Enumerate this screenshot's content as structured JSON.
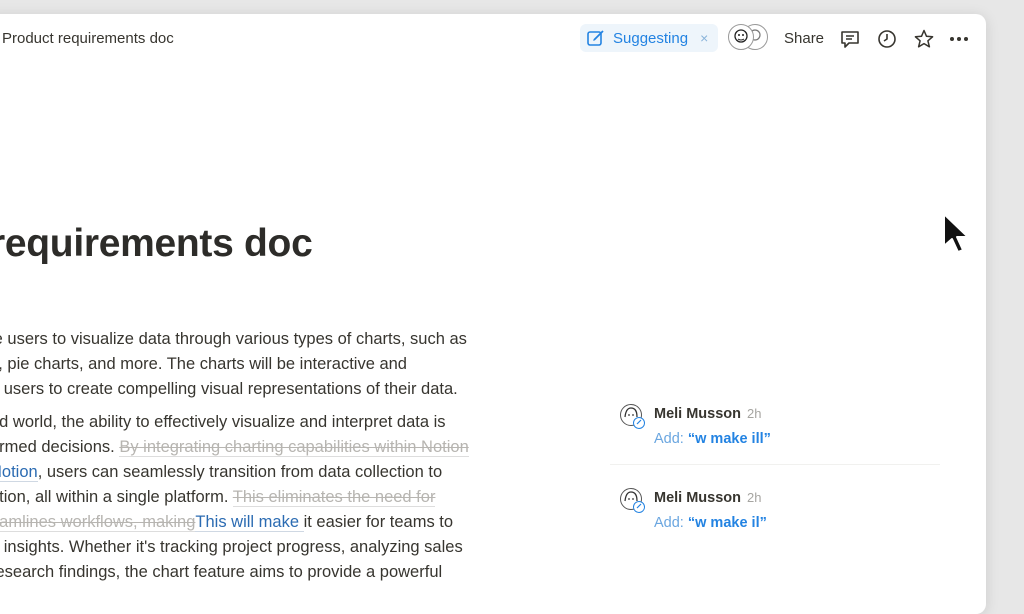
{
  "topbar": {
    "title": "Product requirements doc",
    "mode_label": "Suggesting",
    "mode_close": "×",
    "share_label": "Share",
    "icons": [
      "suggest-pencil-icon",
      "comments-icon",
      "history-icon",
      "favorite-star-icon",
      "more-icon"
    ]
  },
  "doc": {
    "heading": "requirements doc",
    "p1": [
      "le users to visualize data through various types of charts, such as",
      "s, pie charts, and more. The charts will be interactive and",
      "g users to create compelling visual representations of their data."
    ],
    "p2_l1": "ed world, the ability to effectively visualize and interpret data is",
    "p2_l2_a": "ormed decisions. ",
    "p2_l2_strike": "By integrating charting capabilities within Notion",
    "p2_l3_ins": "Notion",
    "p2_l3_b": ", users can seamlessly transition from data collection to",
    "p2_l4_a": "ation, all within a single platform. ",
    "p2_l4_strike": "This eliminates the need for",
    "p2_l5_strike": "eamlines workflows, making",
    "p2_l5_ins": "This will make ",
    "p2_l5_b": " it easier for teams to",
    "p2_l6": "e insights. Whether it's tracking project progress, analyzing sales",
    "p2_l7": "research findings, the chart feature aims to provide a powerful"
  },
  "comments": [
    {
      "author": "Meli Musson",
      "time": "2h",
      "action": "Add:",
      "value": "“w make ill”"
    },
    {
      "author": "Meli Musson",
      "time": "2h",
      "action": "Add:",
      "value": "“w make il”"
    }
  ]
}
